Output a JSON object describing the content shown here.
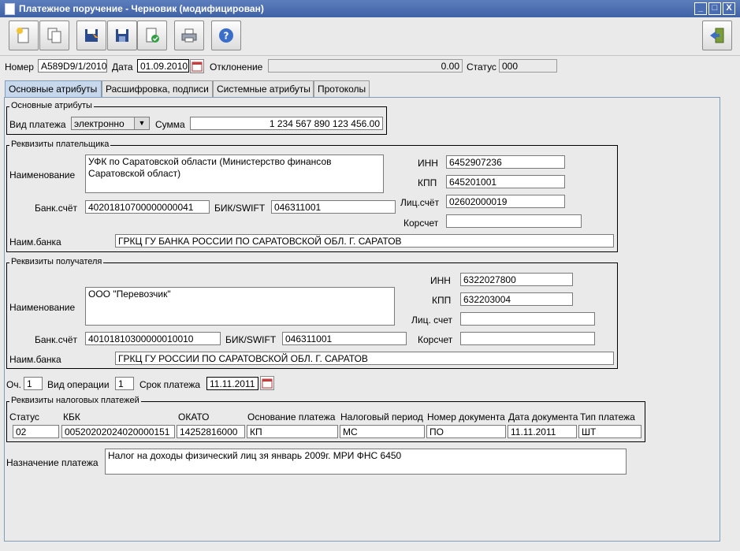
{
  "window": {
    "title": "Платежное поручение - Черновик (модифицирован)",
    "btn_min": "_",
    "btn_max": "□",
    "btn_close": "X"
  },
  "toolbar": {
    "buttons": [
      "new-doc-icon",
      "copy-doc-icon",
      "save-as-icon",
      "save-icon",
      "sign-doc-icon",
      "print-icon",
      "help-icon"
    ],
    "exit": "exit-icon"
  },
  "header": {
    "num_label": "Номер",
    "num_value": "A589D9/1/2010",
    "date_label": "Дата",
    "date_value": "01.09.2010",
    "dev_label": "Отклонение",
    "dev_value": "0.00",
    "status_label": "Статус",
    "status_value": "000"
  },
  "tabs": [
    "Основные атрибуты",
    "Расшифровка, подписи",
    "Системные атрибуты",
    "Протоколы"
  ],
  "basic": {
    "group_title": "Основные атрибуты",
    "paytype_label": "Вид платежа",
    "paytype_value": "электронно",
    "sum_label": "Сумма",
    "sum_value": "1 234 567 890 123 456.00"
  },
  "payer": {
    "group_title": "Реквизиты плательщика",
    "name_label": "Наименование",
    "name_value": "УФК по Саратовской области (Министерство финансов Саратовской област)",
    "inn_label": "ИНН",
    "inn_value": "6452907236",
    "kpp_label": "КПП",
    "kpp_value": "645201001",
    "acc_label": "Банк.счёт",
    "acc_value": "40201810700000000041",
    "bic_label": "БИК/SWIFT",
    "bic_value": "046311001",
    "pers_label": "Лиц.счёт",
    "pers_value": "02602000019",
    "corr_label": "Корсчет",
    "corr_value": "",
    "bank_label": "Наим.банка",
    "bank_value": "ГРКЦ ГУ БАНКА РОССИИ ПО САРАТОВСКОЙ ОБЛ. Г. САРАТОВ"
  },
  "payee": {
    "group_title": "Реквизиты получателя",
    "name_label": "Наименование",
    "name_value": "ООО \"Перевозчик\"",
    "inn_label": "ИНН",
    "inn_value": "6322027800",
    "kpp_label": "КПП",
    "kpp_value": "632203004",
    "pers_label": "Лиц. счет",
    "pers_value": "",
    "acc_label": "Банк.счёт",
    "acc_value": "40101810300000010010",
    "bic_label": "БИК/SWIFT",
    "bic_value": "046311001",
    "corr_label": "Корсчет",
    "corr_value": "",
    "bank_label": "Наим.банка",
    "bank_value": "ГРКЦ ГУ РОССИИ ПО САРАТОВСКОЙ ОБЛ. Г. САРАТОВ"
  },
  "ops": {
    "och_label": "Оч.",
    "och_value": "1",
    "op_label": "Вид операции",
    "op_value": "1",
    "term_label": "Срок платежа",
    "term_value": "11.11.2011"
  },
  "tax": {
    "group_title": "Реквизиты налоговых платежей",
    "headers": [
      "Статус",
      "КБК",
      "ОКАТО",
      "Основание платежа",
      "Налоговый период",
      "Номер документа",
      "Дата документа",
      "Тип платежа"
    ],
    "values": [
      "02",
      "00520202024020000151",
      "14252816000",
      "КП",
      "МС",
      "ПО",
      "11.11.2011",
      "ШТ"
    ]
  },
  "purpose": {
    "label": "Назначение платежа",
    "value": "Налог на доходы физический лиц зя январь 2009г. МРИ ФНС 6450"
  }
}
